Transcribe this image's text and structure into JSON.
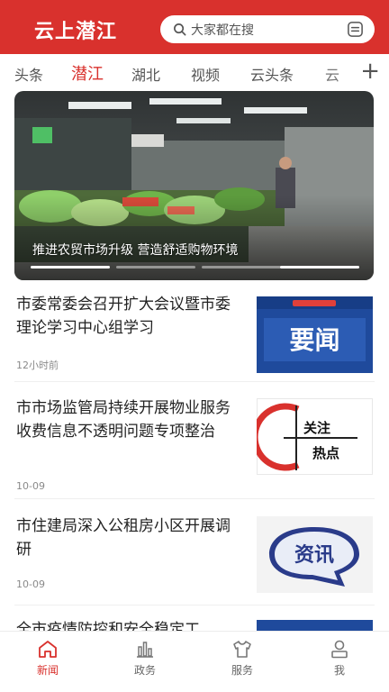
{
  "header": {
    "logo": "云上潜江",
    "search_placeholder": "大家都在搜"
  },
  "tabs": [
    "头条",
    "潜江",
    "湖北",
    "视频",
    "云头条",
    "云"
  ],
  "active_tab": "潜江",
  "banner": {
    "caption": "推进农贸市场升级 营造舒适购物环境",
    "slide_count": 4,
    "active_slide": 1
  },
  "news": [
    {
      "title": "市委常委会召开扩大会议暨市委理论学习中心组学习",
      "time": "12小时前",
      "thumb_text": "要闻"
    },
    {
      "title": "市市场监管局持续开展物业服务收费信息不透明问题专项整治",
      "time": "10-09",
      "thumb_text": "关注热点"
    },
    {
      "title": "市住建局深入公租房小区开展调研",
      "time": "10-09",
      "thumb_text": "资讯"
    },
    {
      "title": "全市疫情防控和安全稳定工",
      "time": "",
      "thumb_text": ""
    }
  ],
  "bottom_nav": [
    {
      "label": "新闻",
      "icon": "home-icon"
    },
    {
      "label": "政务",
      "icon": "chart-icon"
    },
    {
      "label": "服务",
      "icon": "shirt-icon"
    },
    {
      "label": "我",
      "icon": "user-icon"
    }
  ],
  "colors": {
    "brand": "#d9312d",
    "text": "#222222",
    "muted": "#8a8a8a"
  }
}
